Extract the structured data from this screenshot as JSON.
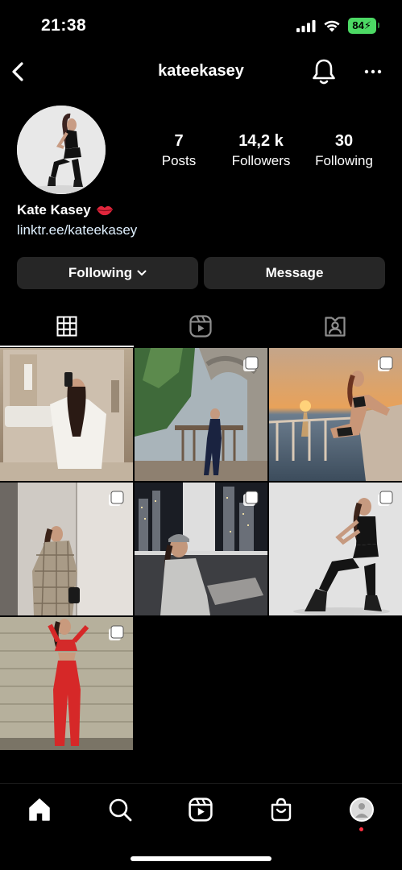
{
  "status_bar": {
    "time": "21:38",
    "battery": "84"
  },
  "header": {
    "username": "kateekasey"
  },
  "profile": {
    "stats": [
      {
        "count": "7",
        "label": "Posts"
      },
      {
        "count": "14,2 k",
        "label": "Followers"
      },
      {
        "count": "30",
        "label": "Following"
      }
    ],
    "name": "Kate Kasey",
    "link": "linktr.ee/kateekasey"
  },
  "actions": {
    "following_label": "Following",
    "message_label": "Message"
  },
  "tabs": [
    "grid-icon",
    "reels-icon",
    "tagged-icon"
  ],
  "active_tab": "grid",
  "posts": [
    {
      "type": "single"
    },
    {
      "type": "multi"
    },
    {
      "type": "multi"
    },
    {
      "type": "multi"
    },
    {
      "type": "multi"
    },
    {
      "type": "multi"
    },
    {
      "type": "multi"
    }
  ],
  "bottom_nav": [
    "home-icon",
    "search-icon",
    "reels-icon",
    "shop-icon",
    "profile-avatar"
  ],
  "colors": {
    "background": "#000000",
    "button_bg": "#262626",
    "link": "#e0f1ff",
    "battery": "#4cd964",
    "notification_dot": "#ff3040"
  }
}
